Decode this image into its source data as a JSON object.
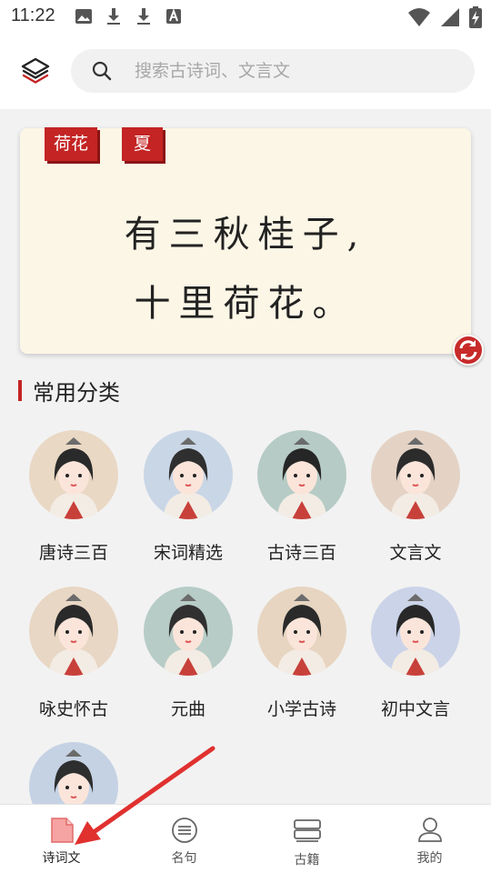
{
  "status_bar": {
    "time": "11:22"
  },
  "search": {
    "placeholder": "搜索古诗词、文言文"
  },
  "poem_card": {
    "tags": [
      "荷花",
      "夏"
    ],
    "lines": [
      "有三秋桂子,",
      "十里荷花。"
    ]
  },
  "section": {
    "title": "常用分类"
  },
  "categories": [
    {
      "label": "唐诗三百",
      "bg": "#e9d8c4"
    },
    {
      "label": "宋词精选",
      "bg": "#c9d6e6"
    },
    {
      "label": "古诗三百",
      "bg": "#b6cbc6"
    },
    {
      "label": "文言文",
      "bg": "#e4d3c5"
    },
    {
      "label": "咏史怀古",
      "bg": "#e8d7c4"
    },
    {
      "label": "元曲",
      "bg": "#b7ccc6"
    },
    {
      "label": "小学古诗",
      "bg": "#e7d5c1"
    },
    {
      "label": "初中文言",
      "bg": "#cbd3e8"
    },
    {
      "label": "",
      "bg": "#c5d2e4"
    }
  ],
  "bottom_nav": [
    {
      "label": "诗词文",
      "icon": "document-icon",
      "active": true
    },
    {
      "label": "名句",
      "icon": "list-circle-icon"
    },
    {
      "label": "古籍",
      "icon": "books-icon"
    },
    {
      "label": "我的",
      "icon": "user-icon"
    }
  ],
  "colors": {
    "accent": "#c42424",
    "card_bg": "#fcf6e6"
  }
}
